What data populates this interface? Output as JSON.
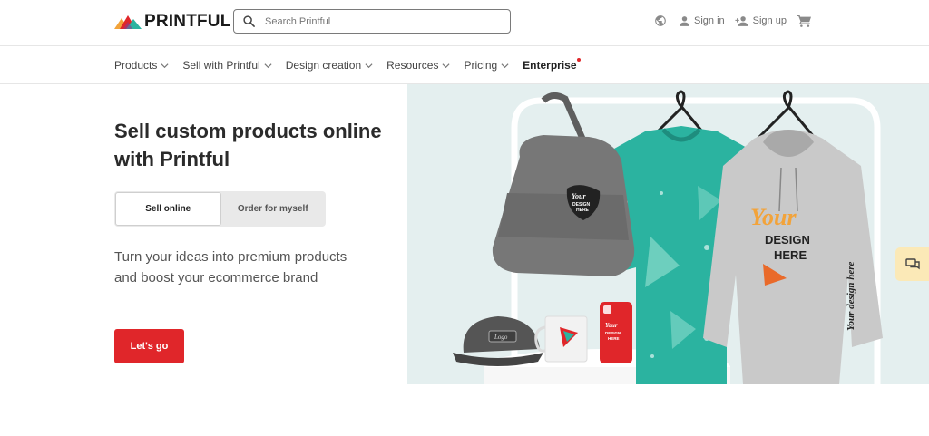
{
  "header": {
    "logo_text": "PRINTFUL",
    "search_placeholder": "Search Printful",
    "sign_in": "Sign in",
    "sign_up": "Sign up"
  },
  "nav": {
    "items": [
      {
        "label": "Products"
      },
      {
        "label": "Sell with Printful"
      },
      {
        "label": "Design creation"
      },
      {
        "label": "Resources"
      },
      {
        "label": "Pricing"
      },
      {
        "label": "Enterprise"
      }
    ]
  },
  "hero": {
    "title": "Sell custom products online with Printful",
    "toggle": [
      "Sell online",
      "Order for myself"
    ],
    "toggle_active": "Sell online",
    "subtitle": "Turn your ideas into premium products and boost your ecommerce brand",
    "cta": "Let's go"
  },
  "mockup": {
    "backpack_print": [
      "Your",
      "DESIGN",
      "HERE"
    ],
    "hoodie_print": [
      "Your",
      "DESIGN",
      "HERE"
    ],
    "sleeve_print": "Your design here",
    "phone_case_print": [
      "Your",
      "DESIGN",
      "HERE"
    ],
    "cap_print": "Logo"
  },
  "colors": {
    "brand_red": "#e0262a",
    "teal_shirt": "#2bb3a0",
    "hero_bg": "#e4efef",
    "chat_bg": "#fbe9b7"
  },
  "icons": [
    "search-icon",
    "globe-icon",
    "user-icon",
    "add-user-icon",
    "cart-icon",
    "chevron-down-icon",
    "chat-icon"
  ]
}
